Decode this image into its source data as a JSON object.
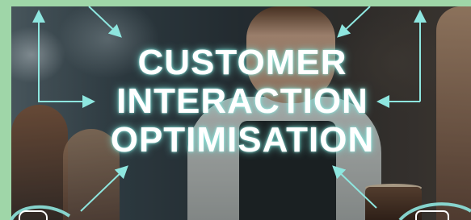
{
  "headline": {
    "line1": "CUSTOMER",
    "line2": "INTERACTION",
    "line3": "OPTIMISATION"
  },
  "colors": {
    "accent": "#8ee6df",
    "frame": "#9fd6a8",
    "text": "#ffffff"
  },
  "icons": [
    "arrow-icon"
  ]
}
